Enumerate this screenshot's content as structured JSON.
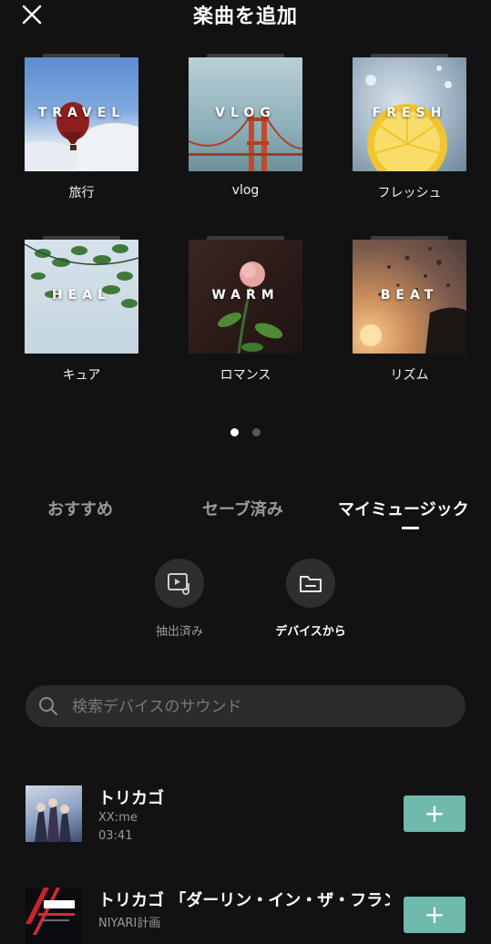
{
  "header": {
    "title": "楽曲を追加"
  },
  "categories": [
    {
      "cover_text": "TRAVEL",
      "label": "旅行"
    },
    {
      "cover_text": "VLOG",
      "label": "vlog"
    },
    {
      "cover_text": "FRESH",
      "label": "フレッシュ"
    },
    {
      "cover_text": "HEAL",
      "label": "キュア"
    },
    {
      "cover_text": "WARM",
      "label": "ロマンス"
    },
    {
      "cover_text": "BEAT",
      "label": "リズム"
    }
  ],
  "pager": {
    "total": 2,
    "active": 1
  },
  "tabs": [
    {
      "label": "おすすめ"
    },
    {
      "label": "セーブ済み"
    },
    {
      "label": "マイミュージック"
    }
  ],
  "active_tab": "マイミュージック",
  "sources": [
    {
      "label": "抽出済み",
      "icon": "extracted-video-music-icon"
    },
    {
      "label": "デバイスから",
      "icon": "folder-icon"
    }
  ],
  "search": {
    "placeholder": "検索デバイスのサウンド",
    "value": ""
  },
  "songs": [
    {
      "title": "トリカゴ",
      "artist": "XX:me",
      "duration": "03:41",
      "add_label": "+"
    },
    {
      "title": "トリカゴ 「ダーリン・イン・ザ・フランキス」",
      "artist": "NIYARI計画",
      "duration": "",
      "add_label": "+"
    }
  ],
  "colors": {
    "background": "#121212",
    "accent": "#6fb9ad",
    "inactive_text": "#9a9a9a"
  }
}
